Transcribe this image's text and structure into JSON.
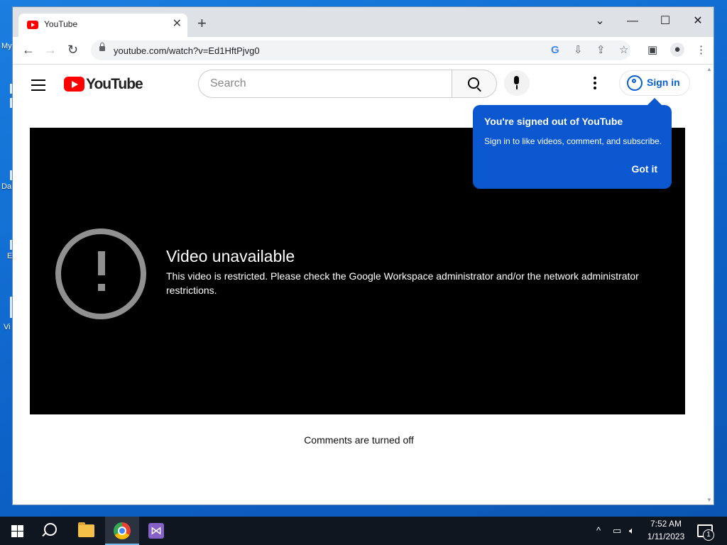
{
  "desktop": {
    "icons": [
      "My",
      "Da",
      "E",
      "Vi"
    ]
  },
  "browser": {
    "tab": {
      "title": "YouTube",
      "close": "✕"
    },
    "new_tab": "+",
    "window_controls": {
      "dropdown": "⌄",
      "minimize": "—",
      "maximize": "☐",
      "close": "✕"
    },
    "nav": {
      "back": "←",
      "forward": "→",
      "reload": "↻"
    },
    "url": "youtube.com/watch?v=Ed1HftPjvg0"
  },
  "youtube": {
    "logo_text": "YouTube",
    "search_placeholder": "Search",
    "sign_in_label": "Sign in",
    "player": {
      "error_title": "Video unavailable",
      "error_message": "This video is restricted. Please check the Google Workspace administrator and/or the network administrator restrictions."
    },
    "comments_status": "Comments are turned off",
    "signed_out_popup": {
      "title": "You're signed out of YouTube",
      "body": "Sign in to like videos, comment, and subscribe.",
      "button": "Got it"
    }
  },
  "taskbar": {
    "clock_time": "7:52 AM",
    "clock_date": "1/11/2023",
    "notification_count": "1"
  },
  "colors": {
    "youtube_red": "#ff0000",
    "popup_blue": "#0b57d0",
    "link_blue": "#065fd4",
    "taskbar": "#101620"
  }
}
